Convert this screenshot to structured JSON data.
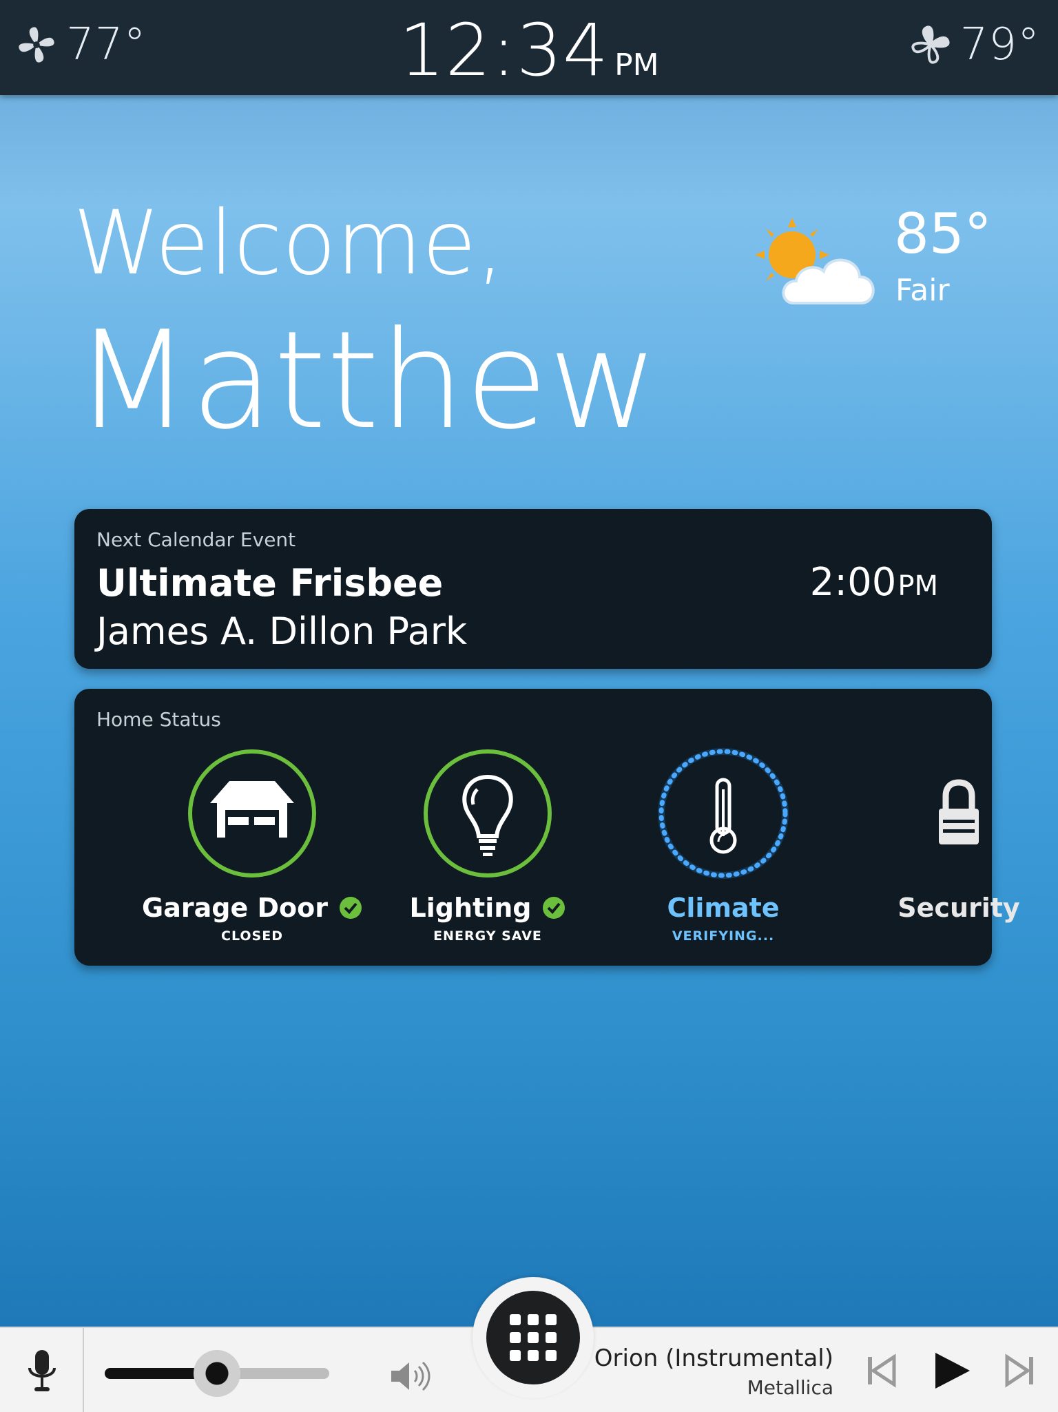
{
  "status_bar": {
    "left_zone": {
      "temp": "77°",
      "icon": "fan-icon"
    },
    "clock": {
      "time": "12:34",
      "ampm": "PM"
    },
    "right_zone": {
      "temp": "79°",
      "icon": "fan-icon"
    }
  },
  "greeting": {
    "welcome": "Welcome,",
    "name": "Matthew"
  },
  "weather": {
    "temp": "85°",
    "condition": "Fair",
    "icon": "partly-sunny-icon"
  },
  "calendar": {
    "label": "Next Calendar Event",
    "title": "Ultimate Frisbee",
    "location": "James A. Dillon Park",
    "time": "2:00",
    "ampm": "PM"
  },
  "home_status": {
    "label": "Home Status",
    "items": [
      {
        "title": "Garage Door",
        "status": "CLOSED",
        "state": "ok",
        "icon": "garage-icon"
      },
      {
        "title": "Lighting",
        "status": "ENERGY SAVE",
        "state": "ok",
        "icon": "lightbulb-icon"
      },
      {
        "title": "Climate",
        "status": "VERIFYING...",
        "state": "pending",
        "icon": "thermometer-icon"
      },
      {
        "title": "Security",
        "status": "",
        "state": "neutral",
        "icon": "lock-icon"
      }
    ]
  },
  "media": {
    "volume": 0.5,
    "track_title": "Orion (Instrumental)",
    "artist": "Metallica"
  },
  "colors": {
    "ok_ring": "#6cbf3d",
    "pending": "#4aa8ff",
    "topbar": "#1c2a36",
    "card": "#0f1a22"
  }
}
